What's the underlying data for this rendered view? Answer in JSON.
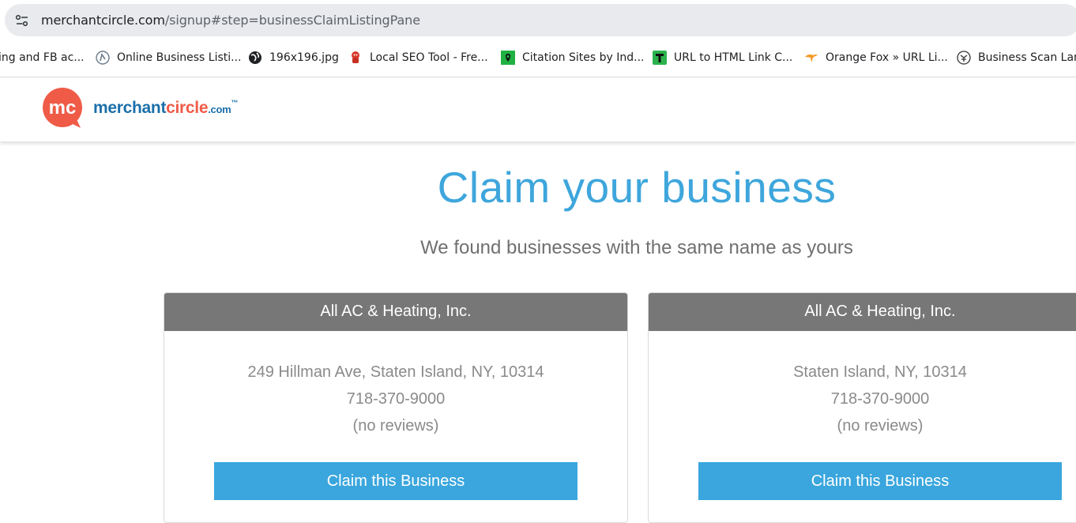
{
  "browser": {
    "url_domain": "merchantcircle.com",
    "url_path": "/signup#step=businessClaimListingPane",
    "bookmarks": [
      {
        "label": "ing and FB ac...",
        "icon": "none"
      },
      {
        "label": "Online Business Listi...",
        "icon": "circle-logo-icon"
      },
      {
        "label": "196x196.jpg",
        "icon": "globe-icon"
      },
      {
        "label": "Local SEO Tool - Fre...",
        "icon": "red-figure-icon"
      },
      {
        "label": "Citation Sites by Ind...",
        "icon": "green-map-icon"
      },
      {
        "label": "URL to HTML Link C...",
        "icon": "green-t-icon"
      },
      {
        "label": "Orange Fox » URL Li...",
        "icon": "orange-fox-icon"
      },
      {
        "label": "Business Scan Landi",
        "icon": "scan-circle-icon"
      }
    ]
  },
  "header": {
    "logo_mark": "mc",
    "logo_merchant": "merchant",
    "logo_circle": "circle",
    "logo_dotcom": ".com",
    "logo_tm": "™"
  },
  "main": {
    "title": "Claim your business",
    "subtitle": "We found businesses with the same name as yours"
  },
  "cards": [
    {
      "name": "All AC & Heating, Inc.",
      "address": "249 Hillman Ave, Staten Island, NY, 10314",
      "phone": "718-370-9000",
      "reviews": "(no reviews)",
      "button": "Claim this Business"
    },
    {
      "name": "All AC & Heating, Inc.",
      "address": "Staten Island, NY, 10314",
      "phone": "718-370-9000",
      "reviews": "(no reviews)",
      "button": "Claim this Business"
    }
  ],
  "colors": {
    "accent_blue": "#3aa6dd",
    "logo_red": "#ef5b47",
    "card_header": "#777777"
  }
}
